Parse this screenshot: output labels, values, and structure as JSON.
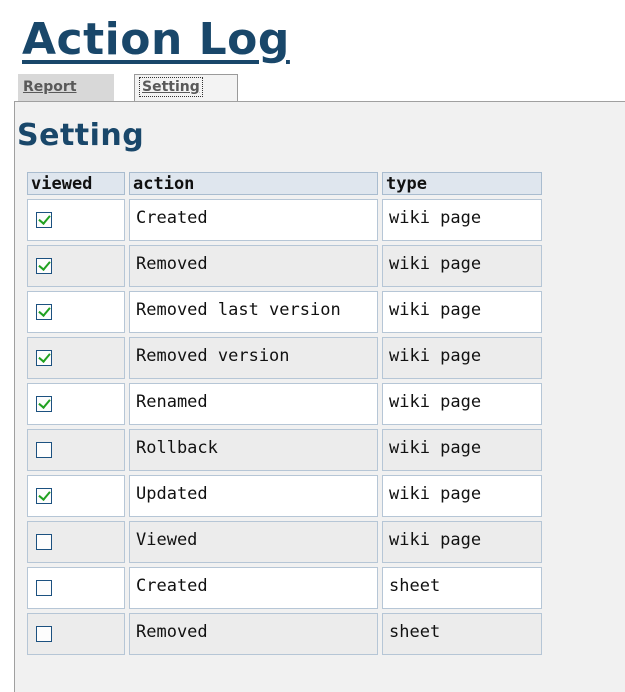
{
  "header": {
    "title": "Action Log"
  },
  "tabs": [
    {
      "label": "Report",
      "active": false
    },
    {
      "label": "Setting",
      "active": true
    }
  ],
  "section": {
    "title": "Setting"
  },
  "table": {
    "columns": [
      "viewed",
      "action",
      "type"
    ],
    "rows": [
      {
        "viewed": true,
        "action": "Created",
        "type": "wiki page"
      },
      {
        "viewed": true,
        "action": "Removed",
        "type": "wiki page"
      },
      {
        "viewed": true,
        "action": "Removed last version",
        "type": "wiki page"
      },
      {
        "viewed": true,
        "action": "Removed version",
        "type": "wiki page"
      },
      {
        "viewed": true,
        "action": "Renamed",
        "type": "wiki page"
      },
      {
        "viewed": false,
        "action": "Rollback",
        "type": "wiki page"
      },
      {
        "viewed": true,
        "action": "Updated",
        "type": "wiki page"
      },
      {
        "viewed": false,
        "action": "Viewed",
        "type": "wiki page"
      },
      {
        "viewed": false,
        "action": "Created",
        "type": "sheet"
      },
      {
        "viewed": false,
        "action": "Removed",
        "type": "sheet"
      }
    ]
  },
  "colors": {
    "title": "#19476a",
    "check": "#21a121",
    "checkbox_border": "#1c5180"
  }
}
